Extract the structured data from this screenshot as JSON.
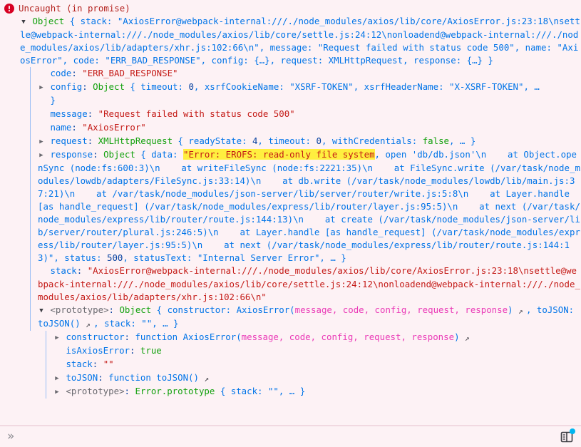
{
  "window": {
    "title": "Firefox DevTools Console - uncaught error",
    "background": "#fdf2f5",
    "error_accent": "#b4231f",
    "highlight_color": "#ffef3f"
  },
  "message": {
    "icon": "error-circle-icon",
    "title": "Uncaught (in promise)"
  },
  "tree": {
    "root": {
      "twisty": "open",
      "label": "Object",
      "preview": " { stack: \"AxiosError@webpack-internal:///./node_modules/axios/lib/core/AxiosError.js:23:18\\nsettle@webpack-internal:///./node_modules/axios/lib/core/settle.js:24:12\\nonloadend@webpack-internal:///./node_modules/axios/lib/adapters/xhr.js:102:66\\n\", message: \"Request failed with status code 500\", name: \"AxiosError\", code: \"ERR_BAD_RESPONSE\", config: {…}, request: XMLHttpRequest, response: {…} }"
    },
    "props": {
      "code_key": "code",
      "code_val": "\"ERR_BAD_RESPONSE\"",
      "config_key": "config",
      "config_cls": "Object",
      "config_preview_a": " { timeout: ",
      "config_timeout": "0",
      "config_preview_b": ", xsrfCookieName: ",
      "config_xsrf_cookie": "\"XSRF-TOKEN\"",
      "config_preview_c": ", xsrfHeaderName: ",
      "config_xsrf_header": "\"X-XSRF-TOKEN\"",
      "config_preview_d": ", …",
      "config_close": "}",
      "message_key": "message",
      "message_val": "\"Request failed with status code 500\"",
      "name_key": "name",
      "name_val": "\"AxiosError\"",
      "request_key": "request",
      "request_cls": "XMLHttpRequest",
      "request_preview_a": " { readyState: ",
      "request_ready": "4",
      "request_preview_b": ", timeout: ",
      "request_timeout": "0",
      "request_preview_c": ", withCredentials: ",
      "request_credentials": "false",
      "request_preview_d": ", … }",
      "response_key": "response",
      "response_cls": "Object",
      "response_open": " { data: ",
      "response_data_highlight": "\"Error: EROFS: read-only file system",
      "response_data_rest": ", open 'db/db.json'\\n    at Object.openSync (node:fs:600:3)\\n    at writeFileSync (node:fs:2221:35)\\n    at FileSync.write (/var/task/node_modules/lowdb/adapters/FileSync.js:33:14)\\n    at db.write (/var/task/node_modules/lowdb/lib/main.js:37:21)\\n    at /var/task/node_modules/json-server/lib/server/router/write.js:5:8\\n    at Layer.handle [as handle_request] (/var/task/node_modules/express/lib/router/layer.js:95:5)\\n    at next (/var/task/node_modules/express/lib/router/route.js:144:13)\\n    at create (/var/task/node_modules/json-server/lib/server/router/plural.js:246:5)\\n    at Layer.handle [as handle_request] (/var/task/node_modules/express/lib/router/layer.js:95:5)\\n    at next (/var/task/node_modules/express/lib/router/route.js:144:13)\"",
      "response_status_key": ", status: ",
      "response_status_val": "500",
      "response_statustext_key": ", statusText: ",
      "response_statustext_val": "\"Internal Server Error\"",
      "response_tail": ", … }",
      "stack_key": "stack",
      "stack_val": "\"AxiosError@webpack-internal:///./node_modules/axios/lib/core/AxiosError.js:23:18\\nsettle@webpack-internal:///./node_modules/axios/lib/core/settle.js:24:12\\nonloadend@webpack-internal:///./node_modules/axios/lib/adapters/xhr.js:102:66\\n\""
    },
    "prototype": {
      "twisty": "open",
      "label": "<prototype>",
      "cls": "Object",
      "open": " { constructor: ",
      "ctor_name": "AxiosError(",
      "ctor_params": "message, code, config, request, response",
      "ctor_close": ")",
      "jump_icon": "jump-to-definition-icon",
      "after_ctor": ", toJSON: ",
      "tojson_preview": "toJSON()",
      "stack_label": ", stack: ",
      "stack_empty": "\"\"",
      "tail": ", … }",
      "children": {
        "constructor_key": "constructor",
        "constructor_kw": "function ",
        "constructor_name": "AxiosError(",
        "constructor_params": "message, code, config, request, response",
        "constructor_close": ")",
        "isaxioserror_key": "isAxiosError",
        "isaxioserror_val": "true",
        "stack_key": "stack",
        "stack_val": "\"\"",
        "tojson_key": "toJSON",
        "tojson_kw": "function ",
        "tojson_val": "toJSON()",
        "proto_key": "<prototype>",
        "proto_cls": "Error.prototype",
        "proto_preview": " { stack: ",
        "proto_stack_val": "\"\"",
        "proto_tail": ", … }"
      }
    }
  },
  "toolbar": {
    "expand_label": "»",
    "expand_icon": "chevron-double-right-icon",
    "split_console_icon": "split-console-icon",
    "badge": "notification-dot"
  }
}
